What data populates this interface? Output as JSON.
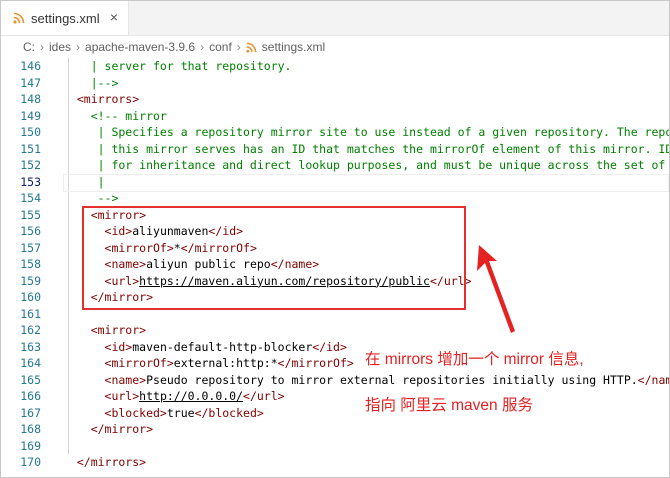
{
  "tab": {
    "filename": "settings.xml",
    "close_glyph": "×"
  },
  "breadcrumb": [
    "C:",
    "ides",
    "apache-maven-3.9.6",
    "conf",
    "settings.xml"
  ],
  "colors": {
    "accent_rss": "#e8912d",
    "annotation": "#e52222",
    "tag": "#800000",
    "comment": "#008000",
    "line_number": "#237893"
  },
  "lines": [
    {
      "n": "146",
      "segs": [
        {
          "t": "    | server for that repository.",
          "c": "cm"
        }
      ]
    },
    {
      "n": "147",
      "segs": [
        {
          "t": "    |-->",
          "c": "cm"
        }
      ]
    },
    {
      "n": "148",
      "segs": [
        {
          "t": "  <mirrors>",
          "c": "tag"
        }
      ]
    },
    {
      "n": "149",
      "segs": [
        {
          "t": "    <!-- mirror",
          "c": "cm"
        }
      ]
    },
    {
      "n": "150",
      "segs": [
        {
          "t": "     | Specifies a repository mirror site to use instead of a given repository. The reposi",
          "c": "cm"
        }
      ]
    },
    {
      "n": "151",
      "segs": [
        {
          "t": "     | this mirror serves has an ID that matches the mirrorOf element of this mirror. IDs",
          "c": "cm"
        }
      ]
    },
    {
      "n": "152",
      "segs": [
        {
          "t": "     | for inheritance and direct lookup purposes, and must be unique across the set of mi",
          "c": "cm"
        }
      ]
    },
    {
      "n": "153",
      "active": true,
      "segs": [
        {
          "t": "     |",
          "c": "cm"
        }
      ]
    },
    {
      "n": "154",
      "segs": [
        {
          "t": "     -->",
          "c": "cm"
        }
      ]
    },
    {
      "n": "155",
      "segs": [
        {
          "t": "    <mirror>",
          "c": "tag"
        }
      ]
    },
    {
      "n": "156",
      "segs": [
        {
          "t": "      <id>",
          "c": "tag"
        },
        {
          "t": "aliyunmaven",
          "c": "val"
        },
        {
          "t": "</id>",
          "c": "tag"
        }
      ]
    },
    {
      "n": "157",
      "segs": [
        {
          "t": "      <mirrorOf>",
          "c": "tag"
        },
        {
          "t": "*",
          "c": "val"
        },
        {
          "t": "</mirrorOf>",
          "c": "tag"
        }
      ]
    },
    {
      "n": "158",
      "segs": [
        {
          "t": "      <name>",
          "c": "tag"
        },
        {
          "t": "aliyun public repo",
          "c": "val"
        },
        {
          "t": "</name>",
          "c": "tag"
        }
      ]
    },
    {
      "n": "159",
      "segs": [
        {
          "t": "      <url>",
          "c": "tag"
        },
        {
          "t": "https://maven.aliyun.com/repository/public",
          "c": "url"
        },
        {
          "t": "</url>",
          "c": "tag"
        }
      ]
    },
    {
      "n": "160",
      "segs": [
        {
          "t": "    </mirror>",
          "c": "tag"
        }
      ]
    },
    {
      "n": "161",
      "segs": [
        {
          "t": "",
          "c": "val"
        }
      ]
    },
    {
      "n": "162",
      "segs": [
        {
          "t": "    <mirror>",
          "c": "tag"
        }
      ]
    },
    {
      "n": "163",
      "segs": [
        {
          "t": "      <id>",
          "c": "tag"
        },
        {
          "t": "maven-default-http-blocker",
          "c": "val"
        },
        {
          "t": "</id>",
          "c": "tag"
        }
      ]
    },
    {
      "n": "164",
      "segs": [
        {
          "t": "      <mirrorOf>",
          "c": "tag"
        },
        {
          "t": "external:http:*",
          "c": "val"
        },
        {
          "t": "</mirrorOf>",
          "c": "tag"
        }
      ]
    },
    {
      "n": "165",
      "segs": [
        {
          "t": "      <name>",
          "c": "tag"
        },
        {
          "t": "Pseudo repository to mirror external repositories initially using HTTP.",
          "c": "val"
        },
        {
          "t": "</name>",
          "c": "tag"
        }
      ]
    },
    {
      "n": "166",
      "segs": [
        {
          "t": "      <url>",
          "c": "tag"
        },
        {
          "t": "http://0.0.0.0/",
          "c": "url"
        },
        {
          "t": "</url>",
          "c": "tag"
        }
      ]
    },
    {
      "n": "167",
      "segs": [
        {
          "t": "      <blocked>",
          "c": "tag"
        },
        {
          "t": "true",
          "c": "val"
        },
        {
          "t": "</blocked>",
          "c": "tag"
        }
      ]
    },
    {
      "n": "168",
      "segs": [
        {
          "t": "    </mirror>",
          "c": "tag"
        }
      ]
    },
    {
      "n": "169",
      "segs": [
        {
          "t": "",
          "c": "val"
        }
      ]
    },
    {
      "n": "170",
      "segs": [
        {
          "t": "  </mirrors>",
          "c": "tag"
        }
      ]
    }
  ],
  "annotation": {
    "line1": "在 mirrors 增加一个 mirror 信息,",
    "line2": "指向 阿里云 maven 服务"
  }
}
